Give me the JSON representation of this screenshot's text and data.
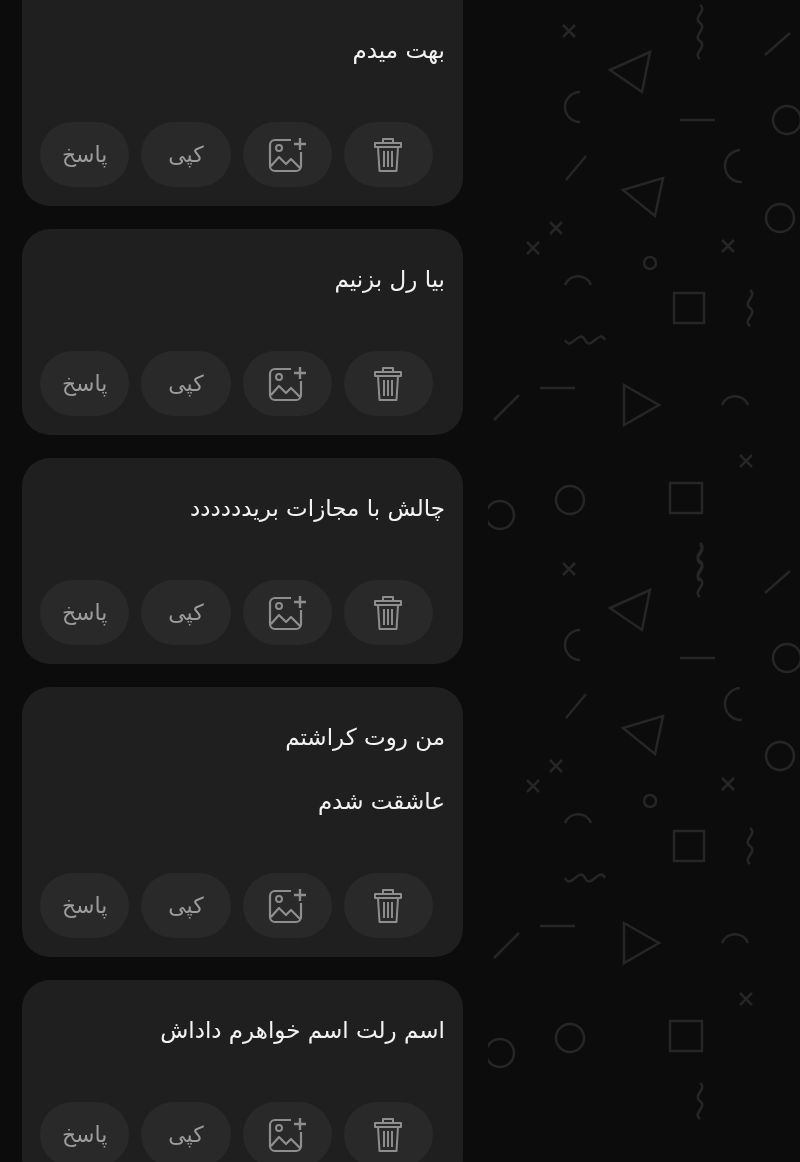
{
  "messages": [
    {
      "lines": [
        "بهت میدم"
      ],
      "actions": [
        {
          "kind": "delete"
        },
        {
          "kind": "image"
        },
        {
          "kind": "copy",
          "label": "کپی"
        },
        {
          "kind": "reply",
          "label": "پاسخ"
        }
      ]
    },
    {
      "lines": [
        "بیا رل بزنیم"
      ],
      "actions": [
        {
          "kind": "delete"
        },
        {
          "kind": "image"
        },
        {
          "kind": "copy",
          "label": "کپی"
        },
        {
          "kind": "reply",
          "label": "پاسخ"
        }
      ]
    },
    {
      "lines": [
        "چالش با مجازات بریدددددد"
      ],
      "actions": [
        {
          "kind": "delete"
        },
        {
          "kind": "image"
        },
        {
          "kind": "copy",
          "label": "کپی"
        },
        {
          "kind": "reply",
          "label": "پاسخ"
        }
      ]
    },
    {
      "lines": [
        "من روت کراشتم",
        "عاشقت شدم"
      ],
      "actions": [
        {
          "kind": "delete"
        },
        {
          "kind": "image"
        },
        {
          "kind": "copy",
          "label": "کپی"
        },
        {
          "kind": "reply",
          "label": "پاسخ"
        }
      ]
    },
    {
      "lines": [
        "اسم رلت اسم خواهرم داداش"
      ],
      "actions": [
        {
          "kind": "delete"
        },
        {
          "kind": "image"
        },
        {
          "kind": "copy",
          "label": "کپی"
        },
        {
          "kind": "reply",
          "label": "پاسخ"
        }
      ]
    }
  ]
}
